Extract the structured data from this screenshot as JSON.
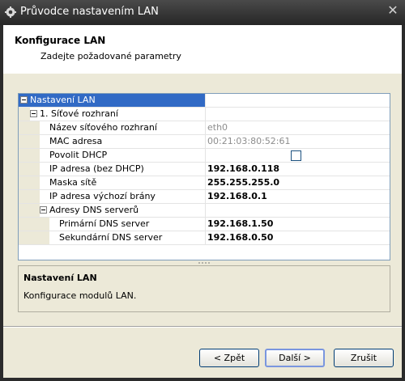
{
  "window": {
    "title": "Průvodce nastavením LAN"
  },
  "header": {
    "title": "Konfigurace LAN",
    "subtitle": "Zadejte požadované parametry"
  },
  "grid": {
    "rows": [
      {
        "label": "Nastavení LAN",
        "value": "",
        "selected": true
      },
      {
        "label": "1. Síťové rozhraní",
        "value": ""
      },
      {
        "label": "Název síťového rozhraní",
        "value": "eth0"
      },
      {
        "label": "MAC adresa",
        "value": "00:21:03:80:52:61"
      },
      {
        "label": "Povolit DHCP",
        "value": "",
        "checked": false
      },
      {
        "label": "IP adresa (bez DHCP)",
        "value": "192.168.0.118"
      },
      {
        "label": "Maska sítě",
        "value": "255.255.255.0"
      },
      {
        "label": "IP adresa výchozí brány",
        "value": "192.168.0.1"
      },
      {
        "label": "Adresy DNS serverů",
        "value": ""
      },
      {
        "label": "Primární DNS server",
        "value": "192.168.1.50"
      },
      {
        "label": "Sekundární DNS server",
        "value": "192.168.0.50"
      }
    ]
  },
  "help": {
    "title": "Nastavení LAN",
    "description": "Konfigurace modulů LAN."
  },
  "buttons": {
    "back": "< Zpět",
    "next": "Další >",
    "cancel": "Zrušit"
  },
  "colors": {
    "selection": "#316ac5",
    "titlebar": "#262626",
    "dialog_bg": "#ece9d8"
  }
}
